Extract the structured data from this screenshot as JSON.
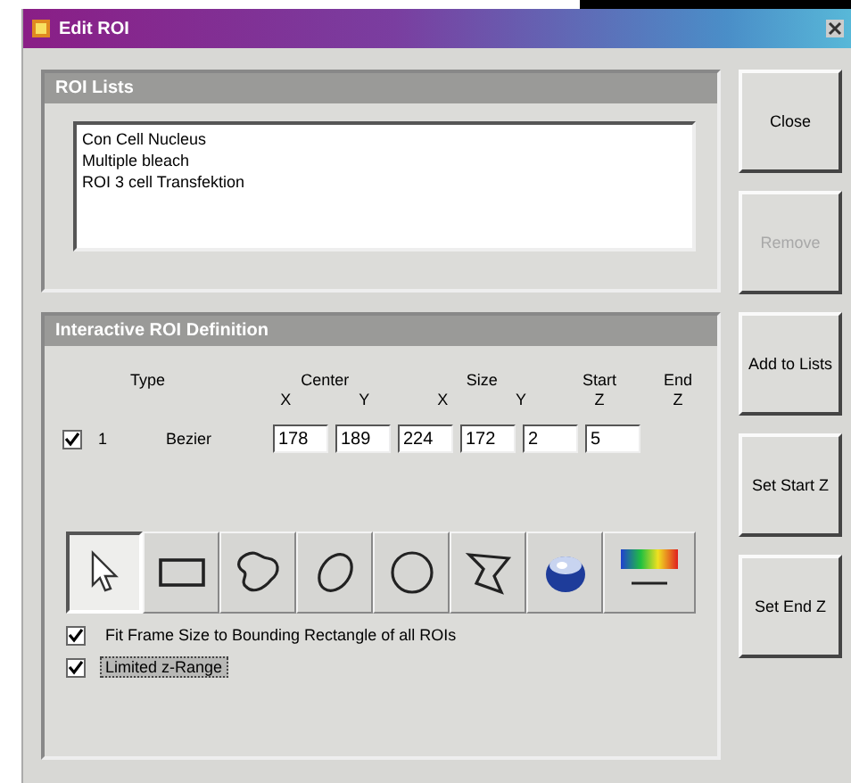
{
  "window": {
    "title": "Edit ROI"
  },
  "roi_lists": {
    "title": "ROI Lists",
    "items": [
      "Con Cell Nucleus",
      "Multiple bleach",
      "ROI 3 cell Transfektion"
    ]
  },
  "side_buttons": [
    {
      "label": "Close",
      "disabled": false
    },
    {
      "label": "Remove",
      "disabled": true
    },
    {
      "label": "Add to Lists",
      "disabled": false
    },
    {
      "label": "Set Start Z",
      "disabled": false
    },
    {
      "label": "Set End Z",
      "disabled": false
    }
  ],
  "definition": {
    "title": "Interactive ROI Definition",
    "headers": [
      {
        "label": "Type"
      },
      {
        "label": "Center",
        "subs": [
          "X",
          "Y"
        ]
      },
      {
        "label": "Size",
        "subs": [
          "X",
          "Y"
        ]
      },
      {
        "label": "Start",
        "subs": [
          "Z"
        ]
      },
      {
        "label": "End",
        "subs": [
          "Z"
        ]
      }
    ],
    "rows": [
      {
        "checked": true,
        "index": "1",
        "type": "Bezier",
        "values": [
          "178",
          "189",
          "224",
          "172",
          "2",
          "5"
        ]
      }
    ],
    "tools": [
      {
        "kind": "pointer",
        "selected": true
      },
      {
        "kind": "rectangle",
        "selected": false
      },
      {
        "kind": "freehand",
        "selected": false
      },
      {
        "kind": "ellipse",
        "selected": false
      },
      {
        "kind": "circle",
        "selected": false
      },
      {
        "kind": "polygon",
        "selected": false
      },
      {
        "kind": "bleach",
        "selected": false
      },
      {
        "kind": "palette",
        "selected": false
      }
    ],
    "options": [
      {
        "label": "Fit Frame Size to Bounding Rectangle of all ROIs",
        "checked": true,
        "focused": false
      },
      {
        "label": "Limited z-Range",
        "checked": true,
        "focused": true
      }
    ]
  }
}
